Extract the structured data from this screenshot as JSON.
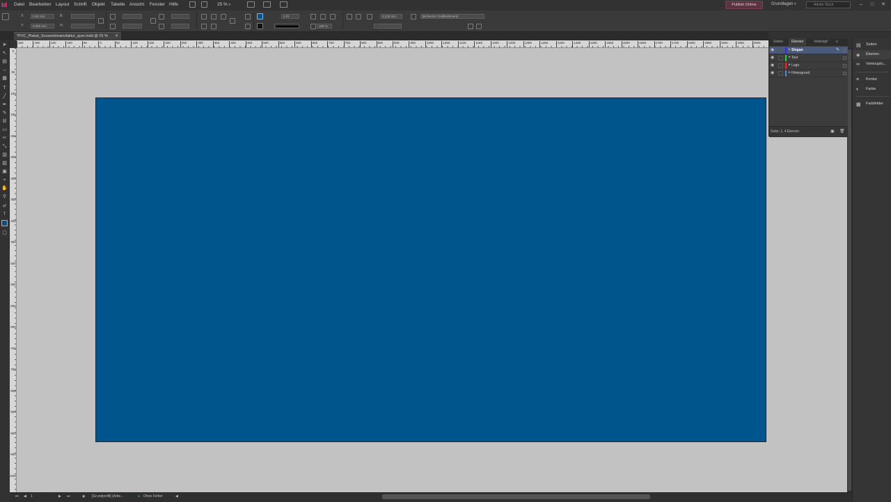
{
  "app": {
    "logo": "Id",
    "menus": [
      "Datei",
      "Bearbeiten",
      "Layout",
      "Schrift",
      "Objekt",
      "Tabelle",
      "Ansicht",
      "Fenster",
      "Hilfe"
    ],
    "zoom": "25 %",
    "publish_label": "Publish Online",
    "workspace": "Grundlagen",
    "stock_search_placeholder": "Adobe Stock"
  },
  "control_panel": {
    "x_label": "X:",
    "y_label": "Y:",
    "w_label": "B:",
    "h_label": "H:",
    "x_value": "0,00 mm",
    "y_value": "0,000 mm",
    "stroke_weight": "1 Pt",
    "opacity": "100 %",
    "dimension_value": "4,233 mm",
    "object_style": "[Einfacher Grafikrahmen]+"
  },
  "document": {
    "tab_title": "*PVC_Plakat_Souvenirmanufaktur_quer.indd @ 25 %",
    "page_color": "#00558c"
  },
  "h_ruler_labels": [
    "250",
    "200",
    "150",
    "100",
    "50",
    "0",
    "50",
    "100",
    "150",
    "200",
    "250",
    "300",
    "350",
    "400",
    "450",
    "500",
    "550",
    "600",
    "650",
    "700",
    "750",
    "800",
    "850",
    "900",
    "950",
    "1000",
    "1050",
    "1100",
    "1150",
    "1200",
    "1250",
    "1300",
    "1350",
    "1400",
    "1450",
    "1500",
    "1550",
    "1600",
    "1650",
    "1700",
    "1750",
    "1800",
    "1850",
    "1900",
    "1950",
    "2000"
  ],
  "v_ruler_labels": [
    "0",
    "50",
    "100",
    "150",
    "200",
    "250",
    "300",
    "350",
    "400",
    "450",
    "500",
    "550",
    "600",
    "650",
    "700",
    "750",
    "800",
    "850",
    "900",
    "950",
    "1000"
  ],
  "layers_panel": {
    "tabs": [
      "Seiten",
      "Ebenen",
      "Verknüpf"
    ],
    "layers": [
      {
        "name": "Slogan",
        "color": "#2a2aff",
        "selected": true
      },
      {
        "name": "Text",
        "color": "#30d030",
        "selected": false
      },
      {
        "name": "Logo",
        "color": "#ff2020",
        "selected": false
      },
      {
        "name": "Hintergrund",
        "color": "#4a8ad8",
        "selected": false
      }
    ],
    "status": "Seite: 1, 4 Ebenen"
  },
  "right_dock": {
    "items": [
      "Seiten",
      "Ebenen",
      "Verknüpfu...",
      "Kontur",
      "Farbe",
      "Farbfelder"
    ]
  },
  "status_bar": {
    "page_number": "1",
    "profile": "[Grundprofil] (Arbe...",
    "preflight": "Ohne Fehler"
  }
}
